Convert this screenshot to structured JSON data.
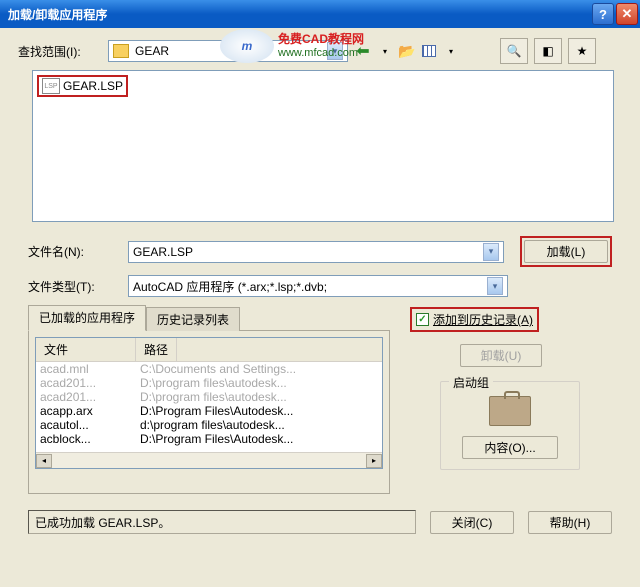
{
  "title": "加载/卸载应用程序",
  "watermark": {
    "line1": "免费CAD教程网",
    "line2": "www.mfcad.com"
  },
  "lookin": {
    "label": "查找范围(I):",
    "value": "GEAR"
  },
  "file_item": "GEAR.LSP",
  "filename": {
    "label": "文件名(N):",
    "value": "GEAR.LSP"
  },
  "filetype": {
    "label": "文件类型(T):",
    "value": "AutoCAD 应用程序 (*.arx;*.lsp;*.dvb;"
  },
  "buttons": {
    "load": "加载(L)",
    "unload": "卸载(U)",
    "contents": "内容(O)...",
    "close": "关闭(C)",
    "help": "帮助(H)"
  },
  "tabs": {
    "loaded": "已加载的应用程序",
    "history": "历史记录列表"
  },
  "list_headers": {
    "file": "文件",
    "path": "路径"
  },
  "loaded_apps": [
    {
      "file": "acad.mnl",
      "path": "C:\\Documents and Settings...",
      "disabled": true
    },
    {
      "file": "acad201...",
      "path": "D:\\program files\\autodesk...",
      "disabled": true
    },
    {
      "file": "acad201...",
      "path": "D:\\program files\\autodesk...",
      "disabled": true
    },
    {
      "file": "acapp.arx",
      "path": "D:\\Program Files\\Autodesk...",
      "disabled": false
    },
    {
      "file": "acautol...",
      "path": "d:\\program files\\autodesk...",
      "disabled": false
    },
    {
      "file": "acblock...",
      "path": "D:\\Program Files\\Autodesk...",
      "disabled": false
    }
  ],
  "add_history": "添加到历史记录(A)",
  "startup_group": "启动组",
  "status": "已成功加载 GEAR.LSP。"
}
